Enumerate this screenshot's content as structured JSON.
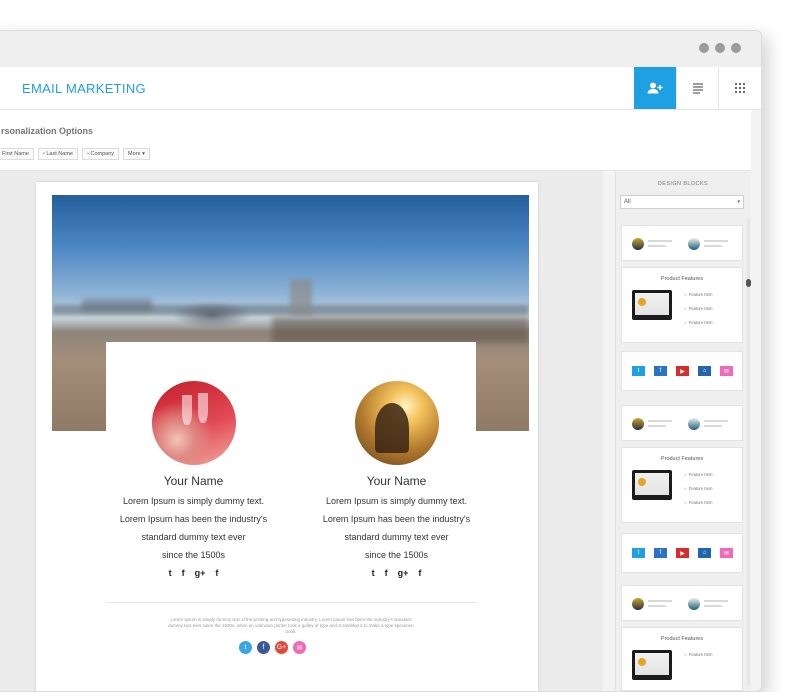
{
  "app": {
    "title": "EMAIL MARKETING",
    "toolbar": [
      {
        "name": "add-user-icon",
        "active": true,
        "glyph": "👤+"
      },
      {
        "name": "list-icon",
        "active": false,
        "glyph": "☰"
      },
      {
        "name": "grid-icon",
        "active": false,
        "glyph": "⋮⋮"
      }
    ]
  },
  "personalization": {
    "title": "rsonalization Options",
    "tags": [
      "First Name",
      "Last Name",
      "Company"
    ],
    "more_label": "More"
  },
  "email": {
    "people": [
      {
        "name": "Your Name",
        "desc": [
          "Lorem Ipsum is simply dummy text.",
          "Lorem Ipsum has been the industry's",
          "standard dummy text ever",
          "since the 1500s"
        ],
        "socials": [
          "t",
          "f",
          "g+",
          "f"
        ]
      },
      {
        "name": "Your Name",
        "desc": [
          "Lorem Ipsum is simply dummy text.",
          "Lorem Ipsum has been the industry's",
          "standard dummy text ever",
          "since the 1500s"
        ],
        "socials": [
          "t",
          "f",
          "g+",
          "f"
        ]
      }
    ],
    "footer_text": "Lorem Ipsum is simply dummy text of the printing and typesetting industry. Lorem Ipsum has been the industry's standard dummy text ever since the 1500s, when an unknown printer took a galley of type and scrambled it to make a type specimen book.",
    "footer_socials": [
      {
        "label": "t",
        "color": "#3aa4e4"
      },
      {
        "label": "f",
        "color": "#3b5998"
      },
      {
        "label": "G+",
        "color": "#e2473a"
      },
      {
        "label": "✉",
        "color": "#f06ab7"
      }
    ]
  },
  "design_blocks": {
    "title": "DESIGN BLOCKS",
    "filter_value": "All",
    "product_features_label": "Product Features",
    "feature_item": "Feature Item",
    "social_colors": [
      "#1ea0e3",
      "#2a73c5",
      "#d52c2c",
      "#2366b0",
      "#f06ab7"
    ]
  },
  "colors": {
    "accent": "#1ea0e3"
  }
}
